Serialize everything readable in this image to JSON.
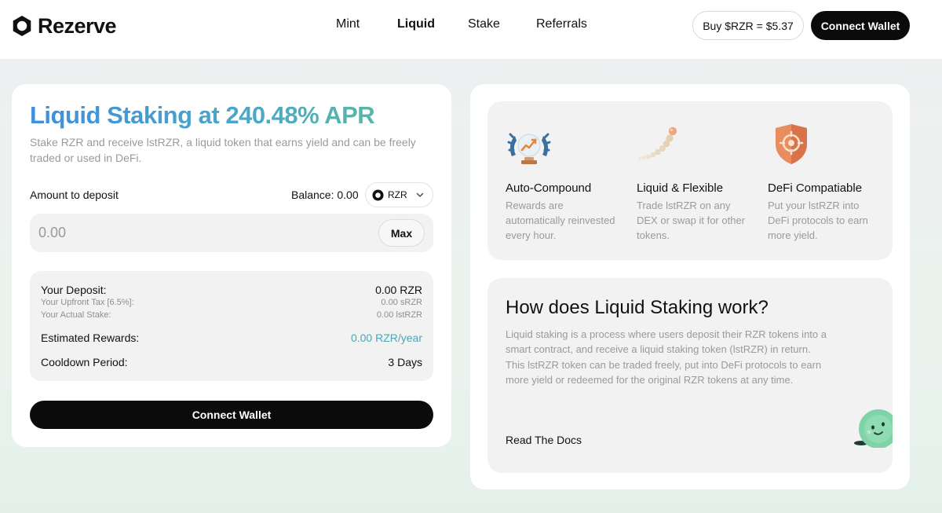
{
  "brand": {
    "name": "Rezerve"
  },
  "nav": {
    "items": [
      {
        "label": "Mint",
        "active": false
      },
      {
        "label": "Liquid",
        "active": true
      },
      {
        "label": "Stake",
        "active": false
      },
      {
        "label": "Referrals",
        "active": false
      }
    ]
  },
  "header": {
    "price_label": "Buy $RZR = $5.37",
    "connect_label": "Connect Wallet"
  },
  "deposit": {
    "title": "Liquid Staking at 240.48% APR",
    "subtitle": "Stake RZR and receive lstRZR, a liquid token that earns yield and can be freely traded or used in DeFi.",
    "amount_label": "Amount to deposit",
    "balance_label": "Balance: 0.00",
    "token": "RZR",
    "amount_placeholder": "0.00",
    "max_label": "Max",
    "summary": {
      "your_deposit_label": "Your Deposit:",
      "your_deposit_value": "0.00 RZR",
      "upfront_tax_label": "Your Upfront Tax [6.5%]:",
      "upfront_tax_value": "0.00 sRZR",
      "actual_stake_label": "Your Actual Stake:",
      "actual_stake_value": "0.00 lstRZR",
      "estimated_rewards_label": "Estimated Rewards:",
      "estimated_rewards_value": "0.00 RZR/year",
      "cooldown_label": "Cooldown Period:",
      "cooldown_value": "3 Days"
    },
    "connect_label": "Connect Wallet"
  },
  "features": [
    {
      "icon": "trophy-chart-icon",
      "title": "Auto-Compound",
      "description": "Rewards are automatically reinvested every hour."
    },
    {
      "icon": "beads-trail-icon",
      "title": "Liquid & Flexible",
      "description": "Trade lstRZR on any DEX or swap it for other tokens."
    },
    {
      "icon": "shield-target-icon",
      "title": "DeFi Compatiable",
      "description": "Put your lstRZR into DeFi protocols to earn more yield."
    }
  ],
  "how": {
    "title": "How does Liquid Staking work?",
    "body": "Liquid staking is a process where users deposit their RZR tokens into a smart contract, and receive a liquid staking token (lstRZR) in return. This lstRZR token can be traded freely, put into DeFi protocols to earn more yield or redeemed for the original RZR tokens at any time.",
    "docs_label": "Read The Docs"
  },
  "colors": {
    "accent_start": "#3d8fe0",
    "accent_end": "#58b7a6",
    "rewards_teal": "#4aa6b6",
    "button_black": "#0b0b0b"
  }
}
